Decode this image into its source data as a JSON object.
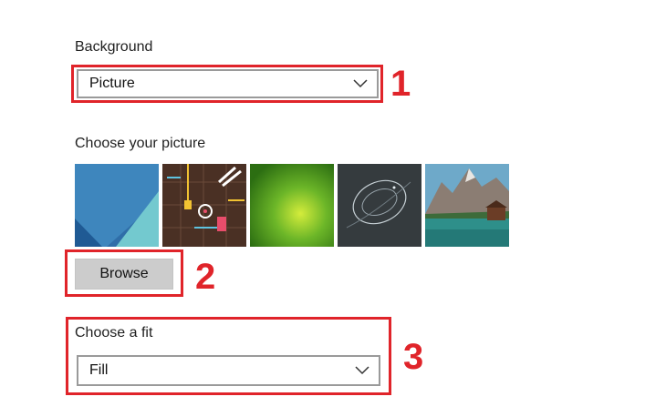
{
  "background": {
    "label": "Background",
    "selected": "Picture"
  },
  "picture": {
    "label": "Choose your picture",
    "thumbnails": [
      {
        "name": "blue-teal-geometric"
      },
      {
        "name": "dark-neon-illustration"
      },
      {
        "name": "green-glow"
      },
      {
        "name": "dark-swirl"
      },
      {
        "name": "mountain-lake"
      }
    ],
    "browse_label": "Browse"
  },
  "fit": {
    "label": "Choose a fit",
    "selected": "Fill"
  },
  "callouts": [
    "1",
    "2",
    "3"
  ],
  "colors": {
    "accent_red": "#e0242a",
    "button_gray": "#cccccc",
    "border_gray": "#9a9a9a"
  }
}
